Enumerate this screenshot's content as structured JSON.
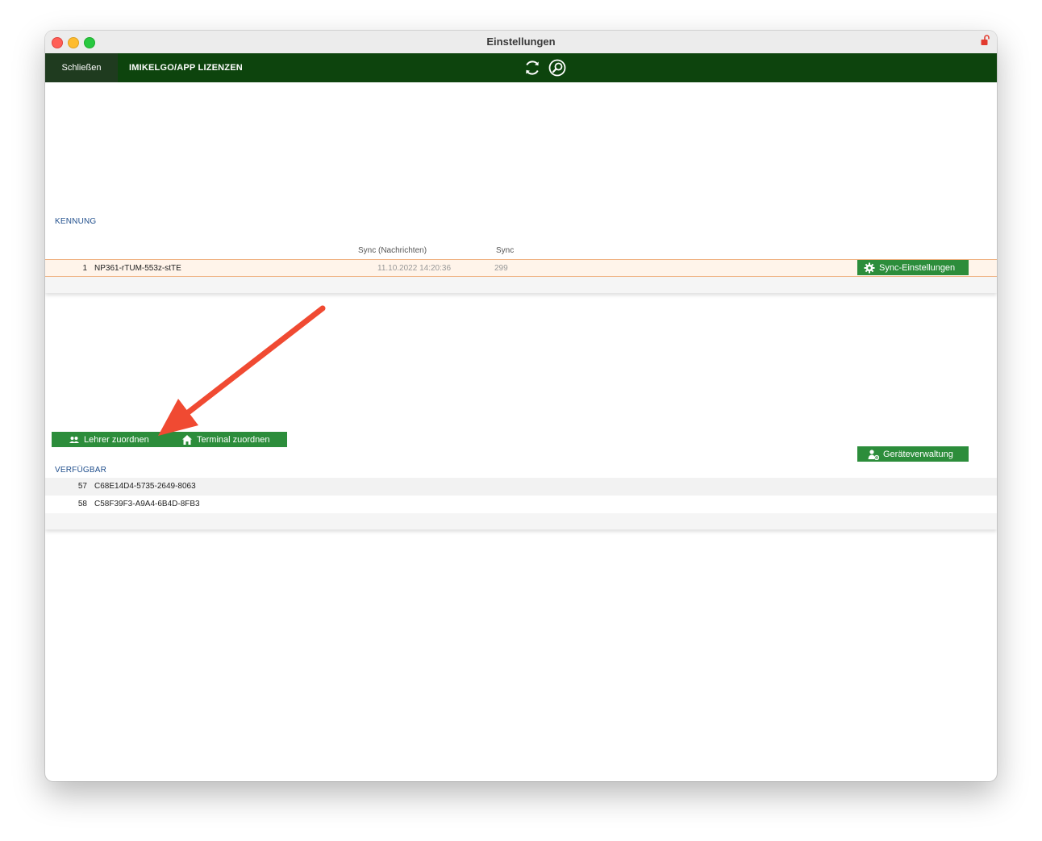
{
  "window": {
    "title": "Einstellungen"
  },
  "toolbar": {
    "close_label": "Schließen",
    "licenses_label": "IMIKELGO/APP LIZENZEN"
  },
  "kennung": {
    "section_label": "KENNUNG",
    "columns": {
      "sync_messages": "Sync (Nachrichten)",
      "sync": "Sync"
    },
    "rows": [
      {
        "num": "1",
        "id": "NP361-rTUM-553z-stTE",
        "sync_messages": "11.10.2022 14:20:36",
        "sync": "299"
      }
    ],
    "sync_settings_button": "Sync-Einstellungen"
  },
  "actions": {
    "assign_teacher": "Lehrer zuordnen",
    "assign_terminal": "Terminal zuordnen",
    "device_management": "Geräteverwaltung"
  },
  "verfuegbar": {
    "section_label": "VERFÜGBAR",
    "rows": [
      {
        "num": "57",
        "id": "C68E14D4-5735-2649-8063"
      },
      {
        "num": "58",
        "id": "C58F39F3-A9A4-6B4D-8FB3"
      }
    ]
  },
  "colors": {
    "toolbar_bg": "#0d440d",
    "button_green": "#2c8d3b",
    "section_label_blue": "#1f4e8c",
    "arrow_red": "#f04a32",
    "selected_row_border": "#f0b383"
  }
}
